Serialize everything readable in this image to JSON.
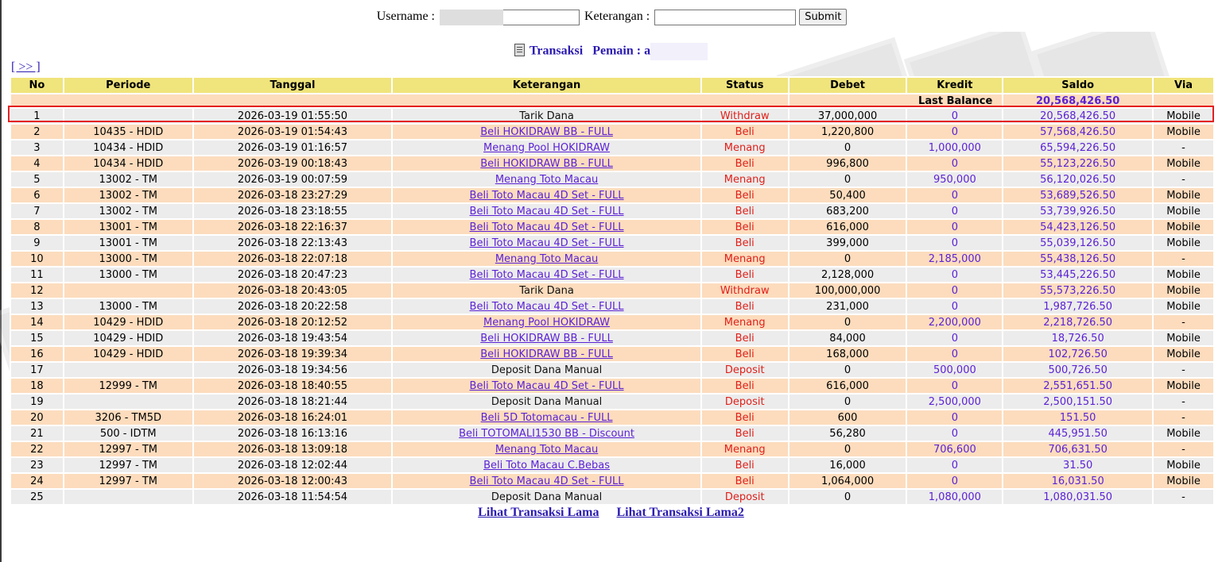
{
  "form": {
    "username_label": "Username :",
    "username_value": "",
    "keterangan_label": "Keterangan :",
    "keterangan_value": "",
    "submit_label": "Submit"
  },
  "title": {
    "transaksi": "Transaksi",
    "pemain_label": "Pemain : a"
  },
  "nav": {
    "next": "[ >> ]"
  },
  "table": {
    "headers": [
      "No",
      "Periode",
      "Tanggal",
      "Keterangan",
      "Status",
      "Debet",
      "Kredit",
      "Saldo",
      "Via"
    ],
    "last_balance_label": "Last Balance",
    "last_balance_value": "20,568,426.50",
    "rows": [
      {
        "no": "1",
        "periode": "",
        "tanggal": "2026-03-19 01:55:50",
        "ket": "Tarik Dana",
        "link": false,
        "status": "Withdraw",
        "debet": "37,000,000",
        "kredit": "0",
        "saldo": "20,568,426.50",
        "via": "Mobile"
      },
      {
        "no": "2",
        "periode": "10435 - HDID",
        "tanggal": "2026-03-19 01:54:43",
        "ket": "Beli HOKIDRAW BB - FULL",
        "link": true,
        "status": "Beli",
        "debet": "1,220,800",
        "kredit": "0",
        "saldo": "57,568,426.50",
        "via": "Mobile"
      },
      {
        "no": "3",
        "periode": "10434 - HDID",
        "tanggal": "2026-03-19 01:16:57",
        "ket": "Menang Pool HOKIDRAW",
        "link": true,
        "status": "Menang",
        "debet": "0",
        "kredit": "1,000,000",
        "saldo": "65,594,226.50",
        "via": "-"
      },
      {
        "no": "4",
        "periode": "10434 - HDID",
        "tanggal": "2026-03-19 00:18:43",
        "ket": "Beli HOKIDRAW BB - FULL",
        "link": true,
        "status": "Beli",
        "debet": "996,800",
        "kredit": "0",
        "saldo": "55,123,226.50",
        "via": "Mobile"
      },
      {
        "no": "5",
        "periode": "13002 - TM",
        "tanggal": "2026-03-19 00:07:59",
        "ket": "Menang Toto Macau",
        "link": true,
        "status": "Menang",
        "debet": "0",
        "kredit": "950,000",
        "saldo": "56,120,026.50",
        "via": "-"
      },
      {
        "no": "6",
        "periode": "13002 - TM",
        "tanggal": "2026-03-18 23:27:29",
        "ket": "Beli Toto Macau 4D Set - FULL",
        "link": true,
        "status": "Beli",
        "debet": "50,400",
        "kredit": "0",
        "saldo": "53,689,526.50",
        "via": "Mobile"
      },
      {
        "no": "7",
        "periode": "13002 - TM",
        "tanggal": "2026-03-18 23:18:55",
        "ket": "Beli Toto Macau 4D Set - FULL",
        "link": true,
        "status": "Beli",
        "debet": "683,200",
        "kredit": "0",
        "saldo": "53,739,926.50",
        "via": "Mobile"
      },
      {
        "no": "8",
        "periode": "13001 - TM",
        "tanggal": "2026-03-18 22:16:37",
        "ket": "Beli Toto Macau 4D Set - FULL",
        "link": true,
        "status": "Beli",
        "debet": "616,000",
        "kredit": "0",
        "saldo": "54,423,126.50",
        "via": "Mobile"
      },
      {
        "no": "9",
        "periode": "13001 - TM",
        "tanggal": "2026-03-18 22:13:43",
        "ket": "Beli Toto Macau 4D Set - FULL",
        "link": true,
        "status": "Beli",
        "debet": "399,000",
        "kredit": "0",
        "saldo": "55,039,126.50",
        "via": "Mobile"
      },
      {
        "no": "10",
        "periode": "13000 - TM",
        "tanggal": "2026-03-18 22:07:18",
        "ket": "Menang Toto Macau",
        "link": true,
        "status": "Menang",
        "debet": "0",
        "kredit": "2,185,000",
        "saldo": "55,438,126.50",
        "via": "-"
      },
      {
        "no": "11",
        "periode": "13000 - TM",
        "tanggal": "2026-03-18 20:47:23",
        "ket": "Beli Toto Macau 4D Set - FULL",
        "link": true,
        "status": "Beli",
        "debet": "2,128,000",
        "kredit": "0",
        "saldo": "53,445,226.50",
        "via": "Mobile"
      },
      {
        "no": "12",
        "periode": "",
        "tanggal": "2026-03-18 20:43:05",
        "ket": "Tarik Dana",
        "link": false,
        "status": "Withdraw",
        "debet": "100,000,000",
        "kredit": "0",
        "saldo": "55,573,226.50",
        "via": "Mobile"
      },
      {
        "no": "13",
        "periode": "13000 - TM",
        "tanggal": "2026-03-18 20:22:58",
        "ket": "Beli Toto Macau 4D Set - FULL",
        "link": true,
        "status": "Beli",
        "debet": "231,000",
        "kredit": "0",
        "saldo": "1,987,726.50",
        "via": "Mobile"
      },
      {
        "no": "14",
        "periode": "10429 - HDID",
        "tanggal": "2026-03-18 20:12:52",
        "ket": "Menang Pool HOKIDRAW",
        "link": true,
        "status": "Menang",
        "debet": "0",
        "kredit": "2,200,000",
        "saldo": "2,218,726.50",
        "via": "-"
      },
      {
        "no": "15",
        "periode": "10429 - HDID",
        "tanggal": "2026-03-18 19:43:54",
        "ket": "Beli HOKIDRAW BB - FULL",
        "link": true,
        "status": "Beli",
        "debet": "84,000",
        "kredit": "0",
        "saldo": "18,726.50",
        "via": "Mobile"
      },
      {
        "no": "16",
        "periode": "10429 - HDID",
        "tanggal": "2026-03-18 19:39:34",
        "ket": "Beli HOKIDRAW BB - FULL",
        "link": true,
        "status": "Beli",
        "debet": "168,000",
        "kredit": "0",
        "saldo": "102,726.50",
        "via": "Mobile"
      },
      {
        "no": "17",
        "periode": "",
        "tanggal": "2026-03-18 19:34:56",
        "ket": "Deposit Dana Manual",
        "link": false,
        "status": "Deposit",
        "debet": "0",
        "kredit": "500,000",
        "saldo": "500,726.50",
        "via": "-"
      },
      {
        "no": "18",
        "periode": "12999 - TM",
        "tanggal": "2026-03-18 18:40:55",
        "ket": "Beli Toto Macau 4D Set - FULL",
        "link": true,
        "status": "Beli",
        "debet": "616,000",
        "kredit": "0",
        "saldo": "2,551,651.50",
        "via": "Mobile"
      },
      {
        "no": "19",
        "periode": "",
        "tanggal": "2026-03-18 18:21:44",
        "ket": "Deposit Dana Manual",
        "link": false,
        "status": "Deposit",
        "debet": "0",
        "kredit": "2,500,000",
        "saldo": "2,500,151.50",
        "via": "-"
      },
      {
        "no": "20",
        "periode": "3206 - TM5D",
        "tanggal": "2026-03-18 16:24:01",
        "ket": "Beli 5D Totomacau - FULL",
        "link": true,
        "status": "Beli",
        "debet": "600",
        "kredit": "0",
        "saldo": "151.50",
        "via": "-"
      },
      {
        "no": "21",
        "periode": "500 - IDTM",
        "tanggal": "2026-03-18 16:13:16",
        "ket": "Beli TOTOMALI1530 BB - Discount",
        "link": true,
        "status": "Beli",
        "debet": "56,280",
        "kredit": "0",
        "saldo": "445,951.50",
        "via": "Mobile"
      },
      {
        "no": "22",
        "periode": "12997 - TM",
        "tanggal": "2026-03-18 13:09:18",
        "ket": "Menang Toto Macau",
        "link": true,
        "status": "Menang",
        "debet": "0",
        "kredit": "706,600",
        "saldo": "706,631.50",
        "via": "-"
      },
      {
        "no": "23",
        "periode": "12997 - TM",
        "tanggal": "2026-03-18 12:02:44",
        "ket": "Beli Toto Macau C.Bebas",
        "link": true,
        "status": "Beli",
        "debet": "16,000",
        "kredit": "0",
        "saldo": "31.50",
        "via": "Mobile"
      },
      {
        "no": "24",
        "periode": "12997 - TM",
        "tanggal": "2026-03-18 12:00:43",
        "ket": "Beli Toto Macau 4D Set - FULL",
        "link": true,
        "status": "Beli",
        "debet": "1,064,000",
        "kredit": "0",
        "saldo": "16,031.50",
        "via": "Mobile"
      },
      {
        "no": "25",
        "periode": "",
        "tanggal": "2026-03-18 11:54:54",
        "ket": "Deposit Dana Manual",
        "link": false,
        "status": "Deposit",
        "debet": "0",
        "kredit": "1,080,000",
        "saldo": "1,080,031.50",
        "via": "-"
      }
    ]
  },
  "footer": {
    "link1": "Lihat Transaksi Lama",
    "link2": "Lihat Transaksi Lama2"
  },
  "colors": {
    "header_bg": "#f0e47c",
    "row_odd": "#ececec",
    "row_even": "#fcdcbd",
    "link": "#5b22d6",
    "status": "#e0201a",
    "highlight_box": "#e41f1f"
  }
}
